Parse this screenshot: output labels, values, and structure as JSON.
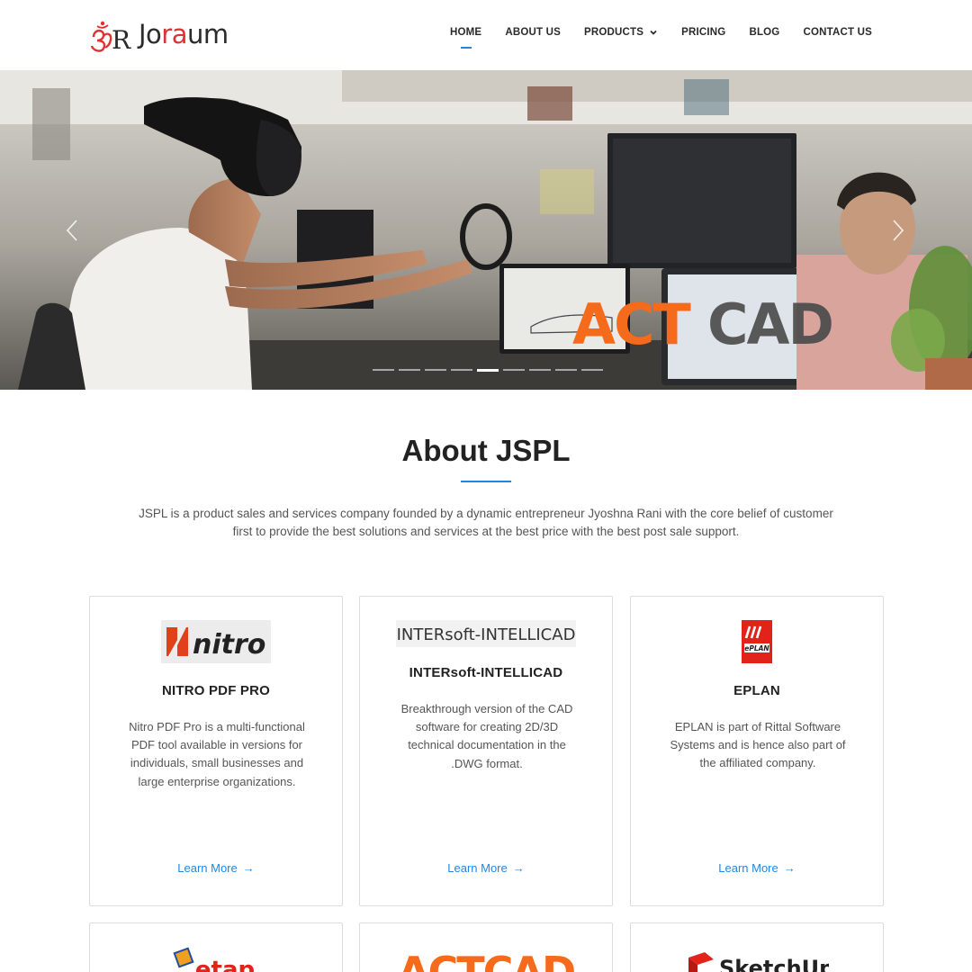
{
  "brand": {
    "logo_text_pre": "Jo",
    "logo_text_accent": "ra",
    "logo_text_post": "um",
    "logo_icon": "om-symbol-logo",
    "accent_color": "#e03131"
  },
  "nav": {
    "items": [
      {
        "label": "HOME",
        "active": true
      },
      {
        "label": "ABOUT US"
      },
      {
        "label": "PRODUCTS",
        "has_dropdown": true
      },
      {
        "label": "PRICING"
      },
      {
        "label": "BLOG"
      },
      {
        "label": "CONTACT US"
      }
    ],
    "accent_color": "#1e88e5"
  },
  "hero": {
    "overlay_brand_text_a": "ACT",
    "overlay_brand_text_b": "CAD",
    "prev_icon": "chevron-left-icon",
    "next_icon": "chevron-right-icon",
    "slide_count": 9,
    "active_slide": 5
  },
  "about": {
    "title": "About JSPL",
    "text": "JSPL is a product sales and services company founded by a dynamic entrepreneur Jyoshna Rani with the core belief of customer first to provide the best solutions and services at the best price with the best post sale support."
  },
  "cards": [
    {
      "logo_text": "nitro",
      "title": "NITRO PDF PRO",
      "desc": "Nitro PDF Pro is a multi-functional PDF tool available in versions for individuals, small businesses and large enterprise organizations.",
      "link": "Learn More"
    },
    {
      "logo_text": "INTERsoft-INTELLICAD",
      "title": "INTERsoft-INTELLICAD",
      "desc": "Breakthrough version of the CAD software for creating 2D/3D technical documentation in the .DWG format.",
      "link": "Learn More"
    },
    {
      "logo_text": "ePLAN",
      "title": "EPLAN",
      "desc": "EPLAN is part of Rittal Software Systems and is hence also part of the affiliated company.",
      "link": "Learn More"
    }
  ],
  "partial_cards": [
    {
      "logo_text": "etap"
    },
    {
      "logo_text": "ACTCAD"
    },
    {
      "logo_text": "SketchUp"
    }
  ]
}
